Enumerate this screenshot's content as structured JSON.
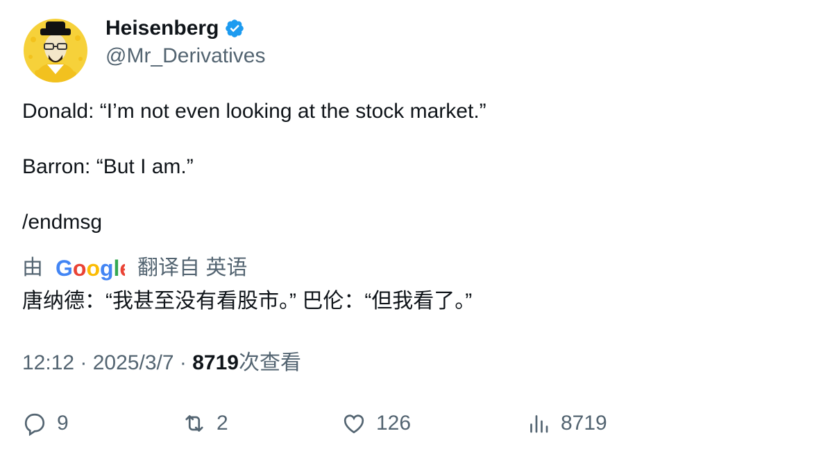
{
  "user": {
    "display_name": "Heisenberg",
    "handle": "@Mr_Derivatives",
    "verified": true,
    "avatar_icon": "heisenberg-avatar-icon"
  },
  "tweet": {
    "lines": [
      "Donald: “I’m not even looking at the stock market.”",
      "Barron: “But I am.”",
      "/endmsg"
    ]
  },
  "translation": {
    "prefix": "由",
    "provider": "Google",
    "suffix": "翻译自 英语",
    "text": "唐纳德：“我甚至没有看股市。” 巴伦：“但我看了。”"
  },
  "meta": {
    "time": "12:12",
    "separator": "·",
    "date": "2025/3/7",
    "views_count": "8719",
    "views_label": "次查看"
  },
  "actions": {
    "replies": "9",
    "retweets": "2",
    "likes": "126",
    "views": "8719"
  },
  "colors": {
    "primary_text": "#0f1419",
    "secondary_text": "#536471",
    "verified_blue": "#1d9bf0",
    "avatar_bg": "#f5c518"
  }
}
